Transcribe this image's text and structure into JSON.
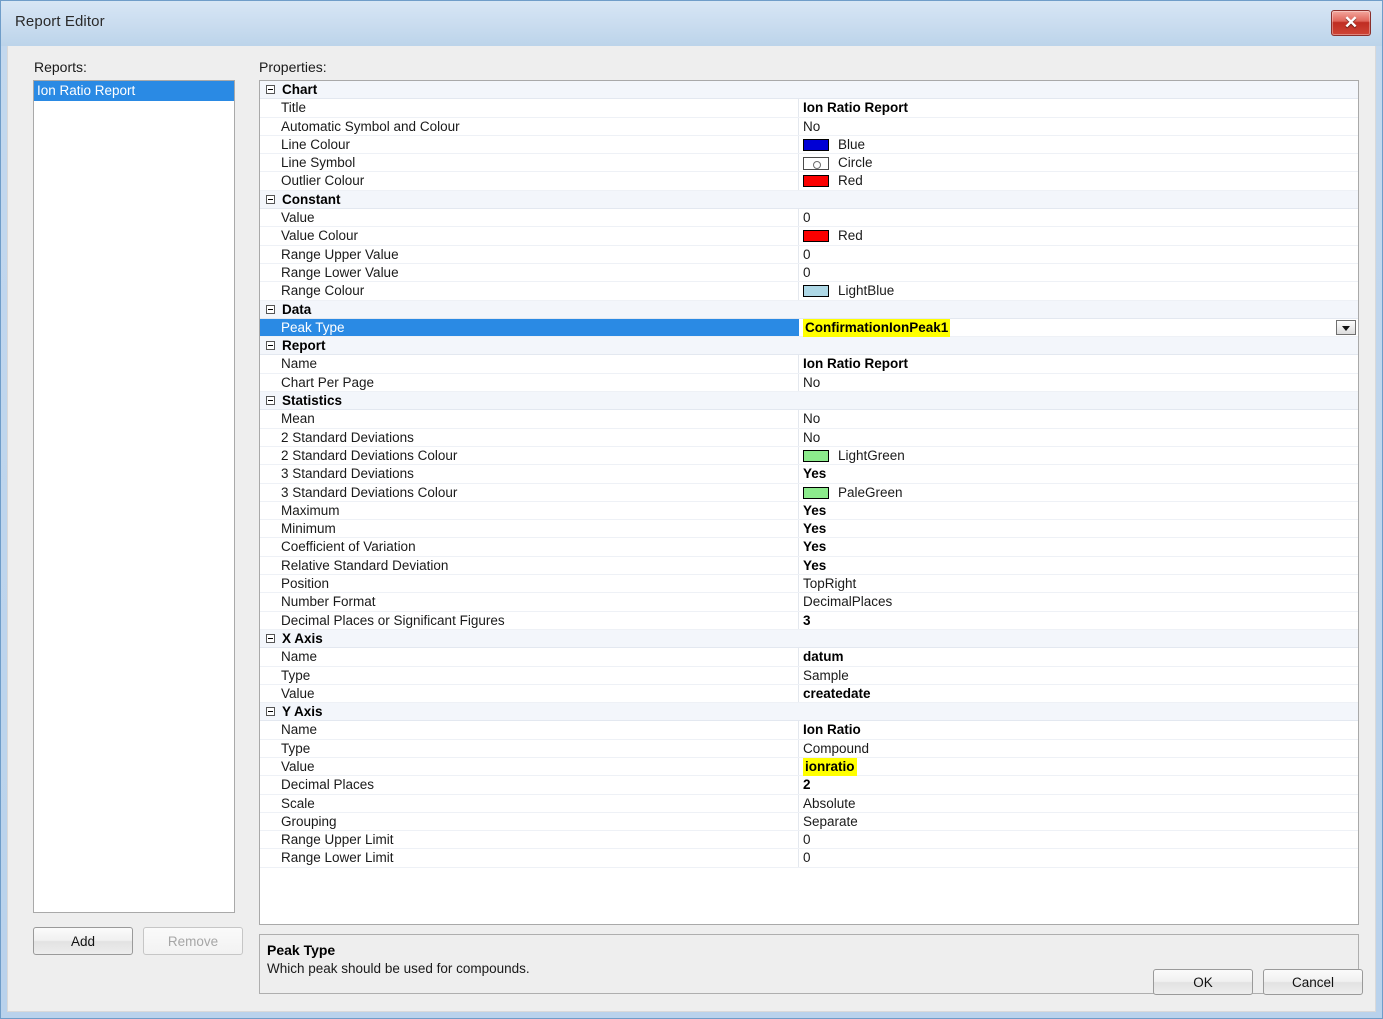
{
  "window": {
    "title": "Report Editor",
    "close_icon": "close-icon",
    "close_glyph": "✕"
  },
  "sidebar": {
    "label": "Reports:",
    "items": [
      {
        "label": "Ion Ratio Report",
        "selected": true
      }
    ],
    "add_label": "Add",
    "remove_label": "Remove",
    "remove_disabled": true
  },
  "properties": {
    "label": "Properties:",
    "categories": [
      {
        "name": "Chart",
        "rows": [
          {
            "name": "Title",
            "value": "Ion Ratio Report",
            "style": "bold"
          },
          {
            "name": "Automatic Symbol and Colour",
            "value": "No",
            "style": "plain"
          },
          {
            "name": "Line Colour",
            "value": "Blue",
            "style": "swatch",
            "swatch": "#0000d5"
          },
          {
            "name": "Line Symbol",
            "value": "Circle",
            "style": "symbol"
          },
          {
            "name": "Outlier Colour",
            "value": "Red",
            "style": "swatch",
            "swatch": "#fb0000"
          }
        ]
      },
      {
        "name": "Constant",
        "rows": [
          {
            "name": "Value",
            "value": "0",
            "style": "plain"
          },
          {
            "name": "Value Colour",
            "value": "Red",
            "style": "swatch",
            "swatch": "#fb0000"
          },
          {
            "name": "Range Upper Value",
            "value": "0",
            "style": "plain"
          },
          {
            "name": "Range Lower Value",
            "value": "0",
            "style": "plain"
          },
          {
            "name": "Range Colour",
            "value": "LightBlue",
            "style": "swatch",
            "swatch": "#aed8e6"
          }
        ]
      },
      {
        "name": "Data",
        "rows": [
          {
            "name": "Peak Type",
            "value": "ConfirmationIonPeak1",
            "style": "editor",
            "selected": true,
            "highlighted": true
          }
        ]
      },
      {
        "name": "Report",
        "rows": [
          {
            "name": "Name",
            "value": "Ion Ratio Report",
            "style": "bold"
          },
          {
            "name": "Chart Per Page",
            "value": "No",
            "style": "plain"
          }
        ]
      },
      {
        "name": "Statistics",
        "rows": [
          {
            "name": "Mean",
            "value": "No",
            "style": "plain"
          },
          {
            "name": "2 Standard Deviations",
            "value": "No",
            "style": "plain"
          },
          {
            "name": "2 Standard Deviations Colour",
            "value": "LightGreen",
            "style": "swatch",
            "swatch": "#8ceb8c"
          },
          {
            "name": "3 Standard Deviations",
            "value": "Yes",
            "style": "bold"
          },
          {
            "name": "3 Standard Deviations Colour",
            "value": "PaleGreen",
            "style": "swatch",
            "swatch": "#8ceb8c"
          },
          {
            "name": "Maximum",
            "value": "Yes",
            "style": "bold"
          },
          {
            "name": "Minimum",
            "value": "Yes",
            "style": "bold"
          },
          {
            "name": "Coefficient of Variation",
            "value": "Yes",
            "style": "bold"
          },
          {
            "name": "Relative Standard Deviation",
            "value": "Yes",
            "style": "bold"
          },
          {
            "name": "Position",
            "value": "TopRight",
            "style": "plain"
          },
          {
            "name": "Number Format",
            "value": "DecimalPlaces",
            "style": "plain"
          },
          {
            "name": "Decimal Places or Significant Figures",
            "value": "3",
            "style": "bold"
          }
        ]
      },
      {
        "name": "X Axis",
        "rows": [
          {
            "name": "Name",
            "value": "datum",
            "style": "bold"
          },
          {
            "name": "Type",
            "value": "Sample",
            "style": "plain"
          },
          {
            "name": "Value",
            "value": "createdate",
            "style": "bold"
          }
        ]
      },
      {
        "name": "Y Axis",
        "rows": [
          {
            "name": "Name",
            "value": "Ion Ratio",
            "style": "bold"
          },
          {
            "name": "Type",
            "value": "Compound",
            "style": "plain"
          },
          {
            "name": "Value",
            "value": "ionratio",
            "style": "bold",
            "highlighted": true
          },
          {
            "name": "Decimal Places",
            "value": "2",
            "style": "bold"
          },
          {
            "name": "Scale",
            "value": "Absolute",
            "style": "plain"
          },
          {
            "name": "Grouping",
            "value": "Separate",
            "style": "plain"
          },
          {
            "name": "Range Upper Limit",
            "value": "0",
            "style": "plain"
          },
          {
            "name": "Range Lower Limit",
            "value": "0",
            "style": "plain"
          }
        ]
      }
    ]
  },
  "description": {
    "title": "Peak Type",
    "body": "Which peak should be used for compounds."
  },
  "footer": {
    "ok_label": "OK",
    "cancel_label": "Cancel"
  },
  "colors": {
    "selection": "#2a8ae4",
    "highlight": "#ffff00",
    "category_bg": "#f3f6fb"
  }
}
